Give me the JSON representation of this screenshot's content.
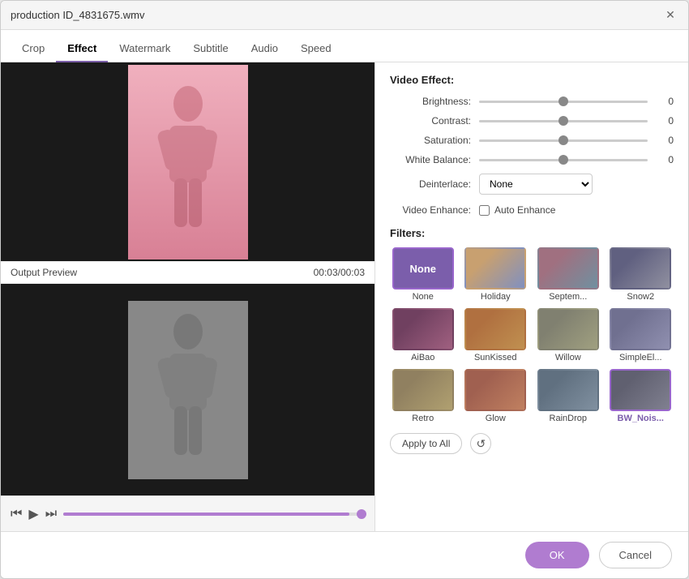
{
  "window": {
    "title": "production ID_4831675.wmv"
  },
  "tabs": [
    {
      "label": "Crop",
      "active": false
    },
    {
      "label": "Effect",
      "active": true
    },
    {
      "label": "Watermark",
      "active": false
    },
    {
      "label": "Subtitle",
      "active": false
    },
    {
      "label": "Audio",
      "active": false
    },
    {
      "label": "Speed",
      "active": false
    }
  ],
  "left": {
    "output_label": "Output Preview",
    "time": "00:03/00:03"
  },
  "right": {
    "video_effect_label": "Video Effect:",
    "brightness_label": "Brightness:",
    "brightness_value": "0",
    "contrast_label": "Contrast:",
    "contrast_value": "0",
    "saturation_label": "Saturation:",
    "saturation_value": "0",
    "white_balance_label": "White Balance:",
    "white_balance_value": "0",
    "deinterlace_label": "Deinterlace:",
    "deinterlace_option": "None",
    "video_enhance_label": "Video Enhance:",
    "auto_enhance_label": "Auto Enhance",
    "filters_label": "Filters:",
    "filters": [
      {
        "label": "None",
        "cls": "none-thumb",
        "selected": true
      },
      {
        "label": "Holiday",
        "cls": "ft-holiday",
        "selected": false
      },
      {
        "label": "Septem...",
        "cls": "ft-sept",
        "selected": false
      },
      {
        "label": "Snow2",
        "cls": "ft-snow2",
        "selected": false
      },
      {
        "label": "AiBao",
        "cls": "ft-aibao",
        "selected": false
      },
      {
        "label": "SunKissed",
        "cls": "ft-sunkissed",
        "selected": false
      },
      {
        "label": "Willow",
        "cls": "ft-willow",
        "selected": false
      },
      {
        "label": "SimpleEl...",
        "cls": "ft-simpleel",
        "selected": false
      },
      {
        "label": "Retro",
        "cls": "ft-retro",
        "selected": false
      },
      {
        "label": "Glow",
        "cls": "ft-glow",
        "selected": false
      },
      {
        "label": "RainDrop",
        "cls": "ft-raindrop",
        "selected": false
      },
      {
        "label": "BW_Nois...",
        "cls": "ft-bwnoise",
        "selected": true
      }
    ],
    "apply_to_all_label": "Apply to All"
  },
  "footer": {
    "ok_label": "OK",
    "cancel_label": "Cancel"
  }
}
